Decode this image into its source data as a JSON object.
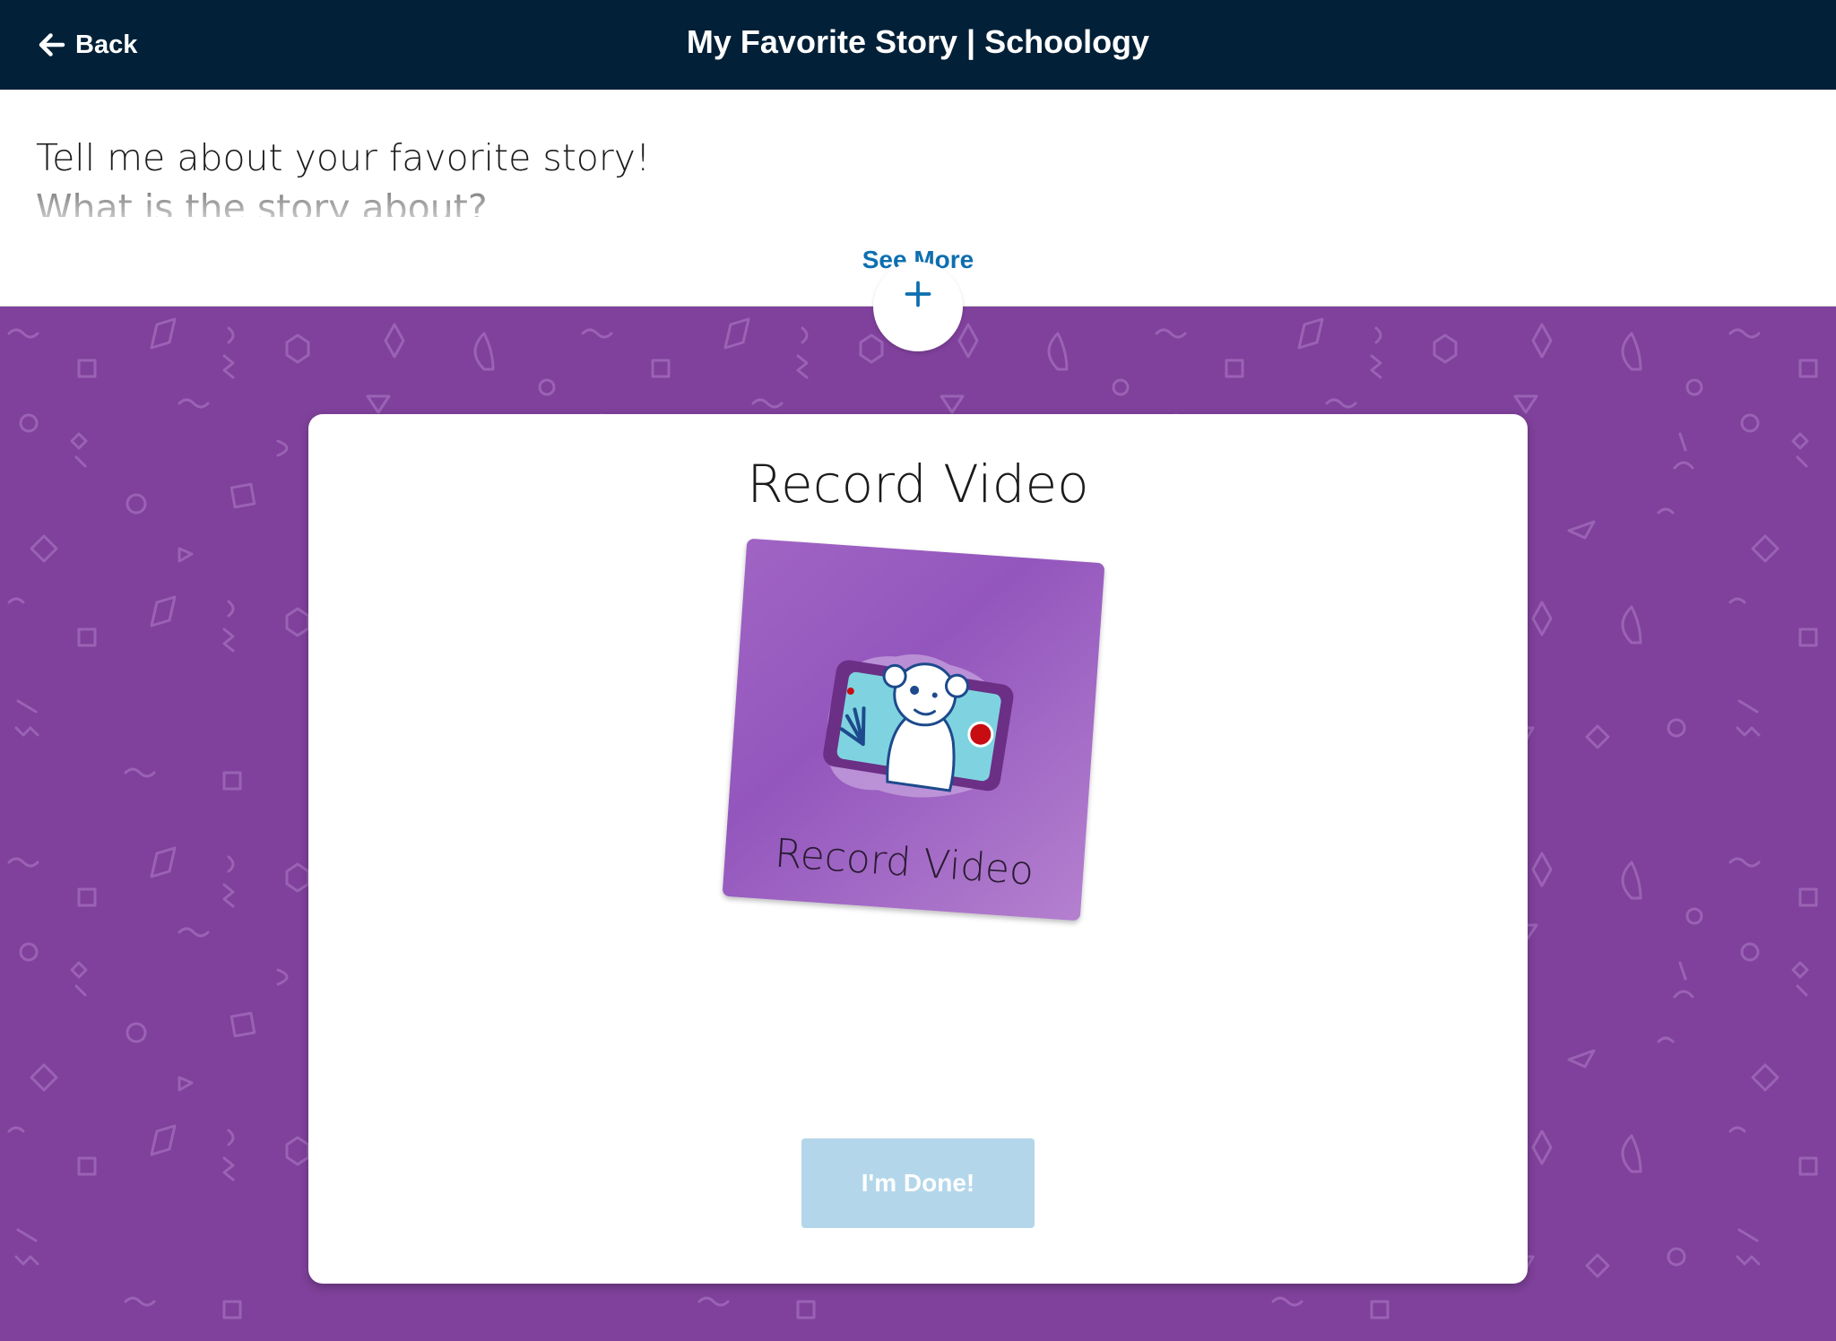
{
  "header": {
    "back_label": "Back",
    "title": "My Favorite Story | Schoology",
    "back_icon": "arrow-left-icon"
  },
  "instructions": {
    "line1": "Tell me about your favorite story!",
    "line2": "What is the story about?",
    "see_more_label": "See More",
    "expand_icon": "plus-icon"
  },
  "card": {
    "title": "Record Video",
    "tile_label": "Record Video",
    "tile_icon": "video-camera-tablet-icon",
    "done_label": "I'm Done!"
  },
  "colors": {
    "header_bg": "#022037",
    "background_purple": "#7f419b",
    "link_blue": "#0d6fb0",
    "done_button_disabled": "#b3d6ea",
    "tile_purple": "#9b5fc2"
  }
}
